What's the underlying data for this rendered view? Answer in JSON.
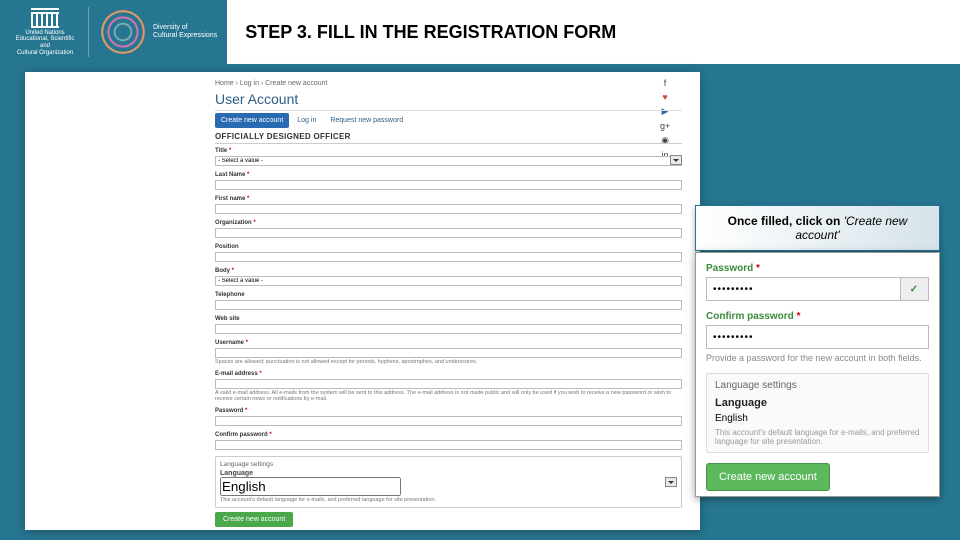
{
  "header": {
    "logos": {
      "unesco_lines": [
        "United Nations",
        "Educational, Scientific and",
        "Cultural Organization"
      ],
      "diversity_lines": [
        "Diversity of",
        "Cultural Expressions"
      ]
    },
    "title": "STEP 3. FILL IN THE REGISTRATION FORM"
  },
  "callout": {
    "prefix": "Once filled, click on ",
    "action": "'Create new account'"
  },
  "form": {
    "breadcrumb": "Home › Log in › Create new account",
    "page_title": "User Account",
    "tabs": {
      "active": "Create new account",
      "t2": "Log in",
      "t3": "Request new password"
    },
    "section": "OFFICIALLY DESIGNED OFFICER",
    "fields": {
      "title": {
        "label": "Title",
        "placeholder": "- Select a value -"
      },
      "last_name": {
        "label": "Last Name"
      },
      "first_name": {
        "label": "First name"
      },
      "organization": {
        "label": "Organization"
      },
      "position": {
        "label": "Position"
      },
      "body": {
        "label": "Body",
        "placeholder": "- Select a value -"
      },
      "telephone": {
        "label": "Telephone"
      },
      "website": {
        "label": "Web site"
      },
      "username": {
        "label": "Username",
        "help": "Spaces are allowed; punctuation is not allowed except for periods, hyphens, apostrophes, and underscores."
      },
      "email": {
        "label": "E-mail address",
        "help": "A valid e-mail address. All e-mails from the system will be sent to this address. The e-mail address is not made public and will only be used if you wish to receive a new password or wish to receive certain news or notifications by e-mail."
      },
      "password": {
        "label": "Password"
      },
      "confirm": {
        "label": "Confirm password"
      }
    },
    "lang": {
      "box_title": "Language settings",
      "label": "Language",
      "value": "English",
      "note": "This account's default language for e-mails, and preferred language for site presentation."
    },
    "submit": "Create new account"
  },
  "zoom": {
    "password_label": "Password",
    "confirm_label": "Confirm password",
    "required": "*",
    "masked": "•••••••••",
    "help": "Provide a password for the new account in both fields.",
    "lang_box_title": "Language settings",
    "lang_label": "Language",
    "lang_value": "English",
    "lang_note": "This account's default language for e-mails, and preferred language for site presentation.",
    "submit": "Create new account"
  },
  "social": [
    "f",
    "♥",
    "▶",
    "g+",
    "◉",
    "in"
  ]
}
